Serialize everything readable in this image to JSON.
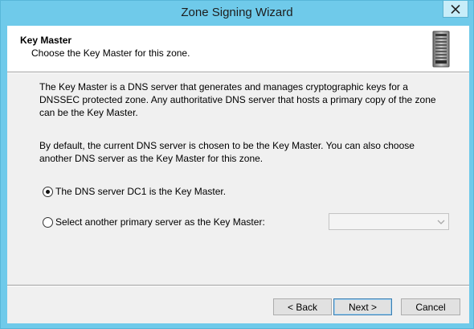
{
  "window": {
    "title": "Zone Signing Wizard"
  },
  "header": {
    "title": "Key Master",
    "subtitle": "Choose the Key Master for this zone.",
    "icon": "server-icon"
  },
  "body": {
    "paragraph1": "The Key Master is a DNS server that generates and manages cryptographic keys for a DNSSEC protected zone. Any authoritative DNS server that hosts a primary copy of the zone can be the Key Master.",
    "paragraph2": "By default, the current DNS server is chosen to be the Key Master. You can also choose another DNS server as the Key Master for this zone."
  },
  "options": {
    "current_server": {
      "label": "The DNS server DC1 is the Key Master.",
      "selected": true
    },
    "another_server": {
      "label": "Select another primary server as the Key Master:",
      "selected": false
    }
  },
  "server_select": {
    "value": "",
    "enabled": false
  },
  "buttons": {
    "back": "< Back",
    "next": "Next >",
    "cancel": "Cancel"
  }
}
